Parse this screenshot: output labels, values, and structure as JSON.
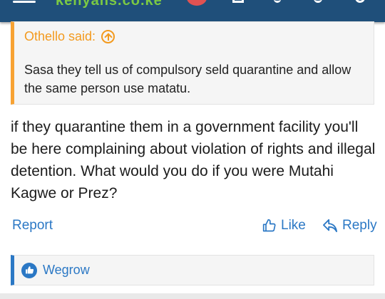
{
  "header": {
    "logo_text": "kenyans.co.ke"
  },
  "quote": {
    "attribution": "Othello said:",
    "text": "Sasa they tell us of compulsory seld quarantine and allow the same person use matatu."
  },
  "post": {
    "text": "if they quarantine them in a government facility you'll be here complaining about violation of rights and illegal detention. What would you do if you were Mutahi Kagwe or Prez?"
  },
  "actions": {
    "report": "Report",
    "like": "Like",
    "reply": "Reply"
  },
  "reactions": {
    "users": "Wegrow"
  },
  "colors": {
    "accent_blue": "#2b78c5",
    "quote_orange": "#f39a1e",
    "header_bg": "#1f4f7a"
  }
}
